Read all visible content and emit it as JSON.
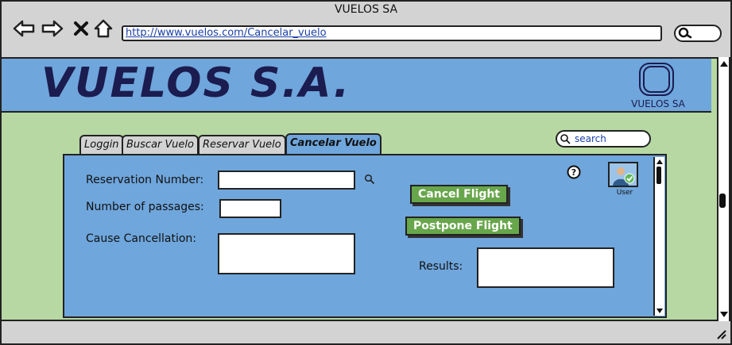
{
  "window": {
    "title": "VUELOS SA",
    "url": "http://www.vuelos.com/Cancelar_vuelo"
  },
  "header": {
    "logo_text": "VUELOS S.A.",
    "logo_caption": "VUELOS SA"
  },
  "tabs": [
    {
      "label": "Loggin"
    },
    {
      "label": "Buscar Vuelo"
    },
    {
      "label": "Reservar Vuelo"
    },
    {
      "label": "Cancelar Vuelo",
      "active": true
    }
  ],
  "search": {
    "placeholder": "search"
  },
  "form": {
    "reservation_label": "Reservation Number:",
    "passages_label": "Number of passages:",
    "cause_label": "Cause Cancellation:",
    "results_label": "Results:"
  },
  "buttons": {
    "cancel": "Cancel Flight",
    "postpone": "Postpone Flight"
  },
  "user": {
    "caption": "User"
  },
  "colors": {
    "header_bg": "#6fa6dc",
    "content_bg": "#b7d8a3",
    "button_bg": "#68a64c",
    "logo_text": "#1b1c4f"
  }
}
